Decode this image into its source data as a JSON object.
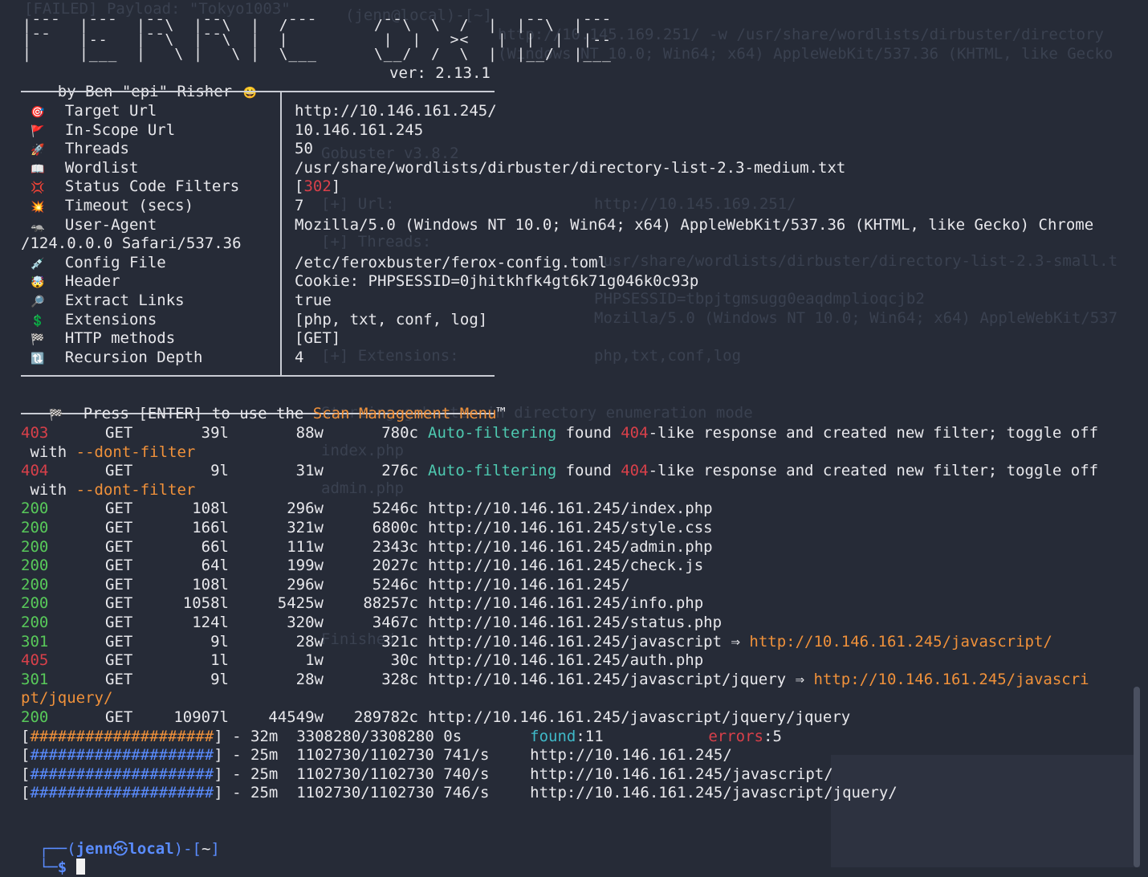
{
  "banner": {
    "art_line1": "|¯¯¯  |¯¯¯  |¯¯\\  |¯¯\\  |  /¯¯¯      /¯¯\\  \\  /  |  |¯¯\\  |¯¯¯",
    "art_line2": "|¯¯   |--   |¯¯\\  |¯¯\\  |  |          |  |   ><   |  |  |  |--",
    "art_line3": "|     |___  |   \\ |   \\ |  \\___      \\__/  /  \\  |  |__/  |___",
    "author": "by Ben \"epi\" Risher",
    "version": "ver: 2.13.1"
  },
  "config": [
    {
      "icon": "target-icon",
      "emoji": "🎯",
      "label": "Target Url",
      "value": "http://10.146.161.245/"
    },
    {
      "icon": "flag-icon",
      "emoji": "🚩",
      "label": "In-Scope Url",
      "value": "10.146.161.245"
    },
    {
      "icon": "rocket-icon",
      "emoji": "🚀",
      "label": "Threads",
      "value": "50"
    },
    {
      "icon": "book-icon",
      "emoji": "📖",
      "label": "Wordlist",
      "value": "/usr/share/wordlists/dirbuster/directory-list-2.3-medium.txt"
    },
    {
      "icon": "collision-icon",
      "emoji": "💢",
      "label": "Status Code Filters",
      "value_prefix": "[",
      "value_code": "302",
      "value_suffix": "]"
    },
    {
      "icon": "explosion-icon",
      "emoji": "💥",
      "label": "Timeout (secs)",
      "value": "7"
    },
    {
      "icon": "agent-icon",
      "emoji": "🦡",
      "label": "User-Agent",
      "value": "Mozilla/5.0 (Windows NT 10.0; Win64; x64) AppleWebKit/537.36 (KHTML, like Gecko) Chrome",
      "wrap": "/124.0.0.0 Safari/537.36"
    },
    {
      "icon": "syringe-icon",
      "emoji": "💉",
      "label": "Config File",
      "value": "/etc/feroxbuster/ferox-config.toml"
    },
    {
      "icon": "head-icon",
      "emoji": "🤯",
      "label": "Header",
      "value": "Cookie: PHPSESSID=0jhitkhfk4gt6k71g046k0c93p"
    },
    {
      "icon": "magnifier-icon",
      "emoji": "🔎",
      "label": "Extract Links",
      "value": "true"
    },
    {
      "icon": "dollar-icon",
      "emoji": "💲",
      "label": "Extensions",
      "value": "[php, txt, conf, log]"
    },
    {
      "icon": "checkered-flag-icon",
      "emoji": "🏁",
      "label": "HTTP methods",
      "value": "[GET]"
    },
    {
      "icon": "recursion-icon",
      "emoji": "🔃",
      "label": "Recursion Depth",
      "value": "4"
    }
  ],
  "menu_hint": {
    "prefix": "Press [ENTER] to use the ",
    "highlight": "Scan Management Menu",
    "suffix": "™"
  },
  "filters": [
    {
      "status": "403",
      "method": "GET",
      "lines": "39l",
      "words": "88w",
      "chars": "780c",
      "msg1": "Auto-filtering",
      "msg2": " found ",
      "code": "404",
      "msg3": "-like response and created new filter; toggle off",
      "wrap1": "with ",
      "wrap2": "--dont-filter"
    },
    {
      "status": "404",
      "method": "GET",
      "lines": "9l",
      "words": "31w",
      "chars": "276c",
      "msg1": "Auto-filtering",
      "msg2": " found ",
      "code": "404",
      "msg3": "-like response and created new filter; toggle off",
      "wrap1": "with ",
      "wrap2": "--dont-filter"
    }
  ],
  "results": [
    {
      "status": "200",
      "method": "GET",
      "lines": "108l",
      "words": "296w",
      "chars": "5246c",
      "url": "http://10.146.161.245/index.php"
    },
    {
      "status": "200",
      "method": "GET",
      "lines": "166l",
      "words": "321w",
      "chars": "6800c",
      "url": "http://10.146.161.245/style.css"
    },
    {
      "status": "200",
      "method": "GET",
      "lines": "66l",
      "words": "111w",
      "chars": "2343c",
      "url": "http://10.146.161.245/admin.php"
    },
    {
      "status": "200",
      "method": "GET",
      "lines": "64l",
      "words": "199w",
      "chars": "2027c",
      "url": "http://10.146.161.245/check.js"
    },
    {
      "status": "200",
      "method": "GET",
      "lines": "108l",
      "words": "296w",
      "chars": "5246c",
      "url": "http://10.146.161.245/"
    },
    {
      "status": "200",
      "method": "GET",
      "lines": "1058l",
      "words": "5425w",
      "chars": "88257c",
      "url": "http://10.146.161.245/info.php"
    },
    {
      "status": "200",
      "method": "GET",
      "lines": "124l",
      "words": "320w",
      "chars": "3467c",
      "url": "http://10.146.161.245/status.php"
    },
    {
      "status": "301",
      "method": "GET",
      "lines": "9l",
      "words": "28w",
      "chars": "321c",
      "url": "http://10.146.161.245/javascript",
      "redirect": "http://10.146.161.245/javascript/"
    },
    {
      "status": "405",
      "method": "GET",
      "lines": "1l",
      "words": "1w",
      "chars": "30c",
      "url": "http://10.146.161.245/auth.php"
    },
    {
      "status": "301",
      "method": "GET",
      "lines": "9l",
      "words": "28w",
      "chars": "328c",
      "url": "http://10.146.161.245/javascript/jquery",
      "redirect": "http://10.146.161.245/javascri",
      "redirect_wrap": "pt/jquery/"
    },
    {
      "status": "200",
      "method": "GET",
      "lines": "10907l",
      "words": "44549w",
      "chars": "289782c",
      "url": "http://10.146.161.245/javascript/jquery/jquery"
    }
  ],
  "progress": [
    {
      "bar": "####################",
      "time": "32m",
      "count": "3308280/3308280",
      "rate": "0s",
      "found_label": "found",
      "found": ":11",
      "errors_label": "errors",
      "errors": ":5",
      "kind": "total"
    },
    {
      "bar": "####################",
      "time": "25m",
      "count": "1102730/1102730",
      "rate": "741/s",
      "target": "http://10.146.161.245/"
    },
    {
      "bar": "####################",
      "time": "25m",
      "count": "1102730/1102730",
      "rate": "740/s",
      "target": "http://10.146.161.245/javascript/"
    },
    {
      "bar": "####################",
      "time": "25m",
      "count": "1102730/1102730",
      "rate": "746/s",
      "target": "http://10.146.161.245/javascript/jquery/"
    }
  ],
  "prompt": {
    "open": "┌──(",
    "user": "jenn",
    "at": "㉿",
    "host": "local",
    "close": ")-[",
    "dir": "~",
    "end": "]",
    "line2": "└─",
    "sigil": "$ "
  },
  "colors": {
    "background": "#262b37",
    "status_ok": "#58c95a",
    "status_err": "#d8404a",
    "accent": "#f0913a",
    "link": "#3fb9c8"
  }
}
